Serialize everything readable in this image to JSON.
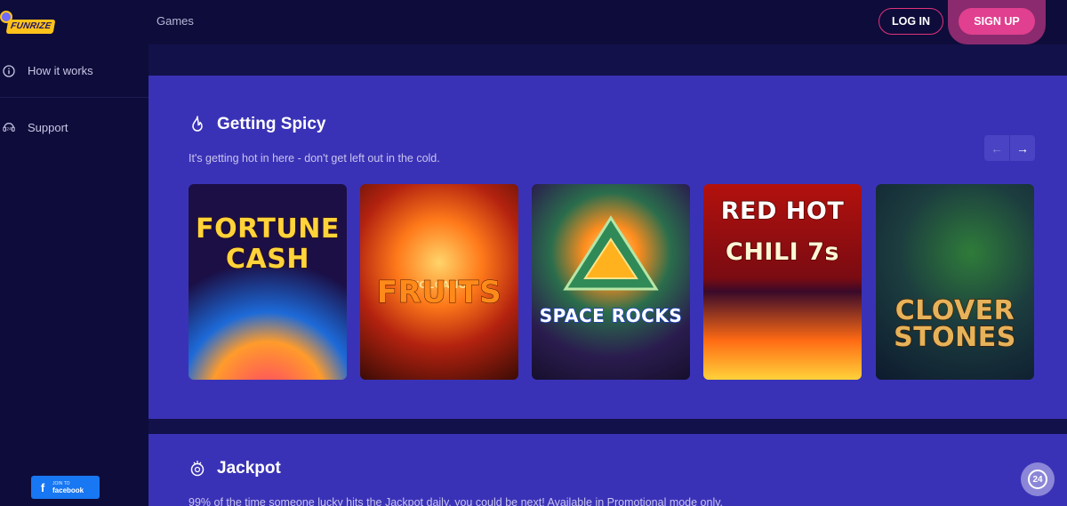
{
  "brand": {
    "logo_text": "FUNRIZE"
  },
  "header": {
    "nav_games": "Games",
    "login_label": "LOG IN",
    "signup_label": "SIGN UP"
  },
  "sidebar": {
    "items": [
      {
        "label": "How it works",
        "icon": "info-icon"
      },
      {
        "label": "Support",
        "icon": "support-24-icon"
      }
    ],
    "facebook": {
      "line1": "JOIN TO",
      "line2": "facebook",
      "icon": "facebook-icon"
    }
  },
  "sections": {
    "getting_spicy": {
      "title": "Getting Spicy",
      "subtitle": "It's getting hot in here - don't get left out in the cold.",
      "icon": "flame-icon",
      "prev_icon": "arrow-left-icon",
      "next_icon": "arrow-right-icon",
      "games": [
        {
          "title_line1": "FORTUNE",
          "title_line2": "CASH"
        },
        {
          "title_top": "VOLCANO",
          "title_main": "FRUITS"
        },
        {
          "title": "SPACE ROCKS"
        },
        {
          "title_line1": "RED HOT",
          "title_line2": "CHILI 7s"
        },
        {
          "title_line1": "CLOVER",
          "title_line2": "STONES"
        }
      ]
    },
    "jackpot": {
      "title": "Jackpot",
      "subtitle": "99% of the time someone lucky hits the Jackpot daily, you could be next! Available in Promotional mode only.",
      "icon": "jackpot-icon"
    }
  },
  "chat": {
    "label": "24",
    "icon": "support-chat-icon"
  },
  "colors": {
    "background": "#0e0c3a",
    "section": "#3a32b6",
    "accent_pink": "#e0408f",
    "login_border": "#e0327a",
    "facebook": "#1877f2"
  }
}
